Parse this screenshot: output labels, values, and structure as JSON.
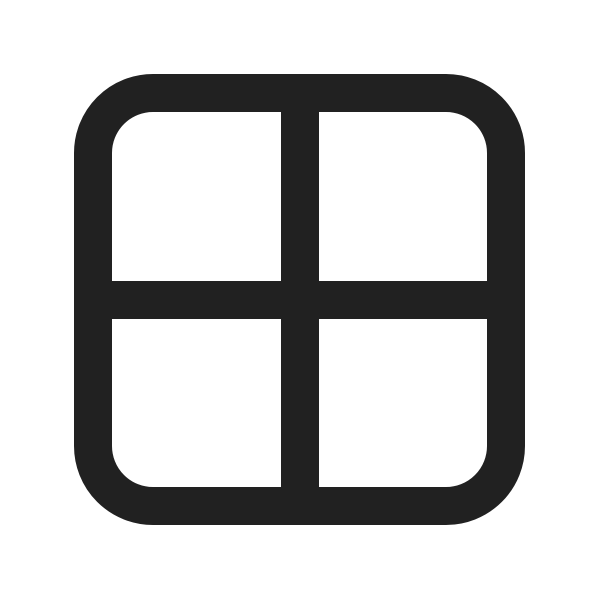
{
  "icon": {
    "name": "grid-icon",
    "stroke_color": "#212121",
    "background_color": "#ffffff"
  }
}
